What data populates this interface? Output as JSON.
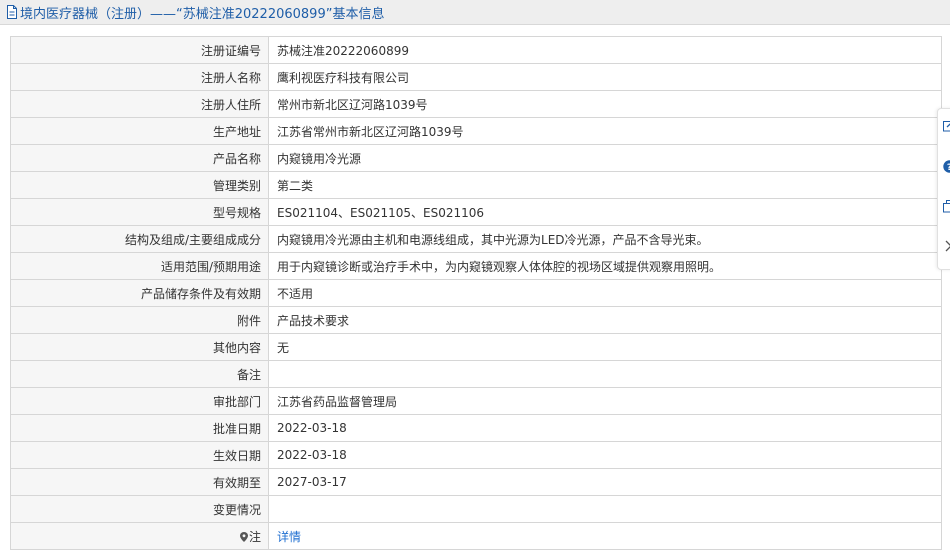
{
  "header": {
    "title": "境内医疗器械（注册）——“苏械注准20222060899”基本信息"
  },
  "rows": [
    {
      "label": "注册证编号",
      "value": "苏械注准20222060899"
    },
    {
      "label": "注册人名称",
      "value": "鹰利视医疗科技有限公司"
    },
    {
      "label": "注册人住所",
      "value": "常州市新北区辽河路1039号"
    },
    {
      "label": "生产地址",
      "value": "江苏省常州市新北区辽河路1039号"
    },
    {
      "label": "产品名称",
      "value": "内窥镜用冷光源"
    },
    {
      "label": "管理类别",
      "value": "第二类"
    },
    {
      "label": "型号规格",
      "value": "ES021104、ES021105、ES021106"
    },
    {
      "label": "结构及组成/主要组成成分",
      "value": "内窥镜用冷光源由主机和电源线组成，其中光源为LED冷光源，产品不含导光束。"
    },
    {
      "label": "适用范围/预期用途",
      "value": "用于内窥镜诊断或治疗手术中，为内窥镜观察人体体腔的视场区域提供观察用照明。"
    },
    {
      "label": "产品储存条件及有效期",
      "value": "不适用"
    },
    {
      "label": "附件",
      "value": "产品技术要求"
    },
    {
      "label": "其他内容",
      "value": "无"
    },
    {
      "label": "备注",
      "value": ""
    },
    {
      "label": "审批部门",
      "value": "江苏省药品监督管理局"
    },
    {
      "label": "批准日期",
      "value": "2022-03-18"
    },
    {
      "label": "生效日期",
      "value": "2022-03-18"
    },
    {
      "label": "有效期至",
      "value": "2027-03-17"
    },
    {
      "label": "变更情况",
      "value": ""
    },
    {
      "label": "注",
      "value": "详情"
    }
  ],
  "icons": {
    "header": "document-icon",
    "note": "location-pin-icon",
    "side": [
      "edit-icon",
      "help-icon",
      "copy-icon",
      "chevron-right-icon"
    ]
  },
  "colors": {
    "title": "#1f5ea8",
    "link": "#1f6fd1",
    "label_bg": "#f6f6f6",
    "border": "#d6d6d6",
    "header_bg": "#eeeeee"
  }
}
